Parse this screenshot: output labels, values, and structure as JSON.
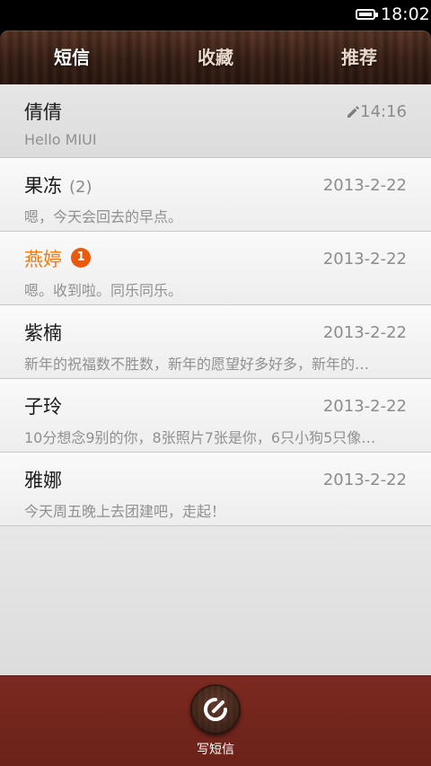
{
  "status_bar": {
    "time": "18:02"
  },
  "tabs": [
    {
      "label": "短信",
      "active": true
    },
    {
      "label": "收藏",
      "active": false
    },
    {
      "label": "推荐",
      "active": false
    }
  ],
  "conversations": [
    {
      "name": "倩倩",
      "count": "",
      "unread_badge": "",
      "date": "14:16",
      "draft_icon": "pencil-icon",
      "preview": "Hello MIUI"
    },
    {
      "name": "果冻",
      "count": "(2)",
      "unread_badge": "",
      "date": "2013-2-22",
      "preview": "嗯，今天会回去的早点。"
    },
    {
      "name": "燕婷",
      "count": "",
      "unread_badge": "1",
      "date": "2013-2-22",
      "preview": "嗯。收到啦。同乐同乐。"
    },
    {
      "name": "紫楠",
      "count": "",
      "unread_badge": "",
      "date": "2013-2-22",
      "preview": "新年的祝福数不胜数，新年的愿望好多好多，新年的…"
    },
    {
      "name": "子玲",
      "count": "",
      "unread_badge": "",
      "date": "2013-2-22",
      "preview": "10分想念9别的你，8张照片7张是你，6只小狗5只像…"
    },
    {
      "name": "雅娜",
      "count": "",
      "unread_badge": "",
      "date": "2013-2-22",
      "preview": "今天周五晚上去团建吧，走起！"
    }
  ],
  "bottom_bar": {
    "compose_label": "写短信"
  },
  "colors": {
    "unread_name": "#ee7a10",
    "badge": "#e85a0c",
    "bottom_bar": "#7b2a20",
    "tab_wood": "#3a2016"
  }
}
